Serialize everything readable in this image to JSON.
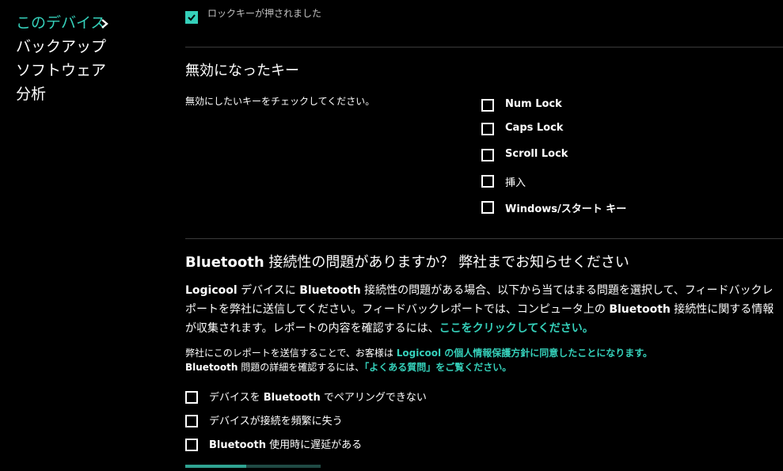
{
  "sidebar": {
    "items": [
      {
        "label": "このデバイス"
      },
      {
        "label": "バックアップ"
      },
      {
        "label": "ソフトウェア"
      },
      {
        "label": "分析"
      }
    ]
  },
  "top_item": {
    "label": "ロックキーが押されました",
    "checked": true
  },
  "disabled_keys": {
    "title": "無効になったキー",
    "description": "無効にしたいキーをチェックしてください。",
    "keys": [
      {
        "label": "Num Lock"
      },
      {
        "label": "Caps Lock"
      },
      {
        "label": "Scroll Lock"
      },
      {
        "label": "挿入"
      },
      {
        "label": "Windows/スタート キー"
      }
    ]
  },
  "bluetooth": {
    "title_brand": "Bluetooth",
    "title_rest": " 接続性の問題がありますか？ 弊社までお知らせください",
    "para": {
      "p1": "Logicool",
      "p2": " デバイスに ",
      "p3": "Bluetooth",
      "p4": " 接続性の問題がある場合、以下から当てはまる問題を選択して、フィードバックレポートを弊社に送信してください。フィードバックレポートでは、コンピュータ上の ",
      "p5": "Bluetooth",
      "p6": " 接続性に関する情報が収集されます。レポートの内容を確認するには、",
      "link": "ここをクリックしてください。"
    },
    "note1_text": "弊社にこのレポートを送信することで、お客様は ",
    "note1_link": "Logicool の個人情報保護方針に同意したことになります。",
    "note2_brand": "Bluetooth",
    "note2_text": " 問題の詳細を確認するには、",
    "note2_link": "「よくある質問」をご覧ください。",
    "issues": [
      {
        "pre": "デバイスを ",
        "brand": "Bluetooth",
        "post": " でペアリングできない"
      },
      {
        "pre": "デバイスが接続を頻繁に失う",
        "brand": "",
        "post": ""
      },
      {
        "pre": "",
        "brand": "Bluetooth",
        "post": " 使用時に遅延がある"
      }
    ]
  },
  "colors": {
    "accent": "#35d0ba",
    "background": "#000000",
    "divider": "#3a3a3a"
  },
  "progress": {
    "fraction": 0.45
  }
}
